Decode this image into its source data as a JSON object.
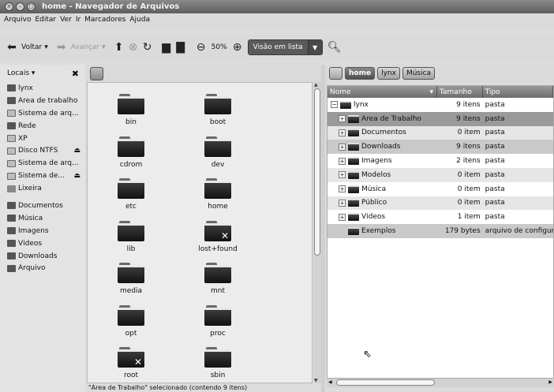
{
  "window": {
    "title": "home - Navegador de Arquivos",
    "buttons": [
      "close",
      "minimize",
      "maximize"
    ]
  },
  "menu": [
    "Arquivo",
    "Editar",
    "Ver",
    "Ir",
    "Marcadores",
    "Ajuda"
  ],
  "toolbar": {
    "back_label": "Voltar",
    "forward_label": "Avançar",
    "zoom_level": "50%",
    "view_mode": "Visão em lista"
  },
  "sidebar": {
    "header": "Locais ▾",
    "items": [
      {
        "label": "lynx",
        "icon": "home-icon"
      },
      {
        "label": "Área de trabalho",
        "icon": "desktop-icon"
      },
      {
        "label": "Sistema de arq...",
        "icon": "drive-icon"
      },
      {
        "label": "Rede",
        "icon": "network-icon"
      },
      {
        "label": "XP",
        "icon": "drive-icon"
      },
      {
        "label": "Disco NTFS",
        "icon": "drive-icon",
        "eject": true
      },
      {
        "label": "Sistema de arq...",
        "icon": "drive-icon"
      },
      {
        "label": "Sistema de...",
        "icon": "drive-icon",
        "eject": true
      },
      {
        "label": "Lixeira",
        "icon": "trash-icon"
      },
      {
        "label": "Documentos",
        "icon": "folder-icon"
      },
      {
        "label": "Música",
        "icon": "folder-icon"
      },
      {
        "label": "Imagens",
        "icon": "folder-icon"
      },
      {
        "label": "Vídeos",
        "icon": "folder-icon"
      },
      {
        "label": "Downloads",
        "icon": "folder-icon"
      },
      {
        "label": "Arquivo",
        "icon": "folder-icon"
      }
    ]
  },
  "icon_view": {
    "items": [
      {
        "label": "bin",
        "broken": false
      },
      {
        "label": "boot",
        "broken": false
      },
      {
        "label": "cdrom",
        "broken": false
      },
      {
        "label": "dev",
        "broken": false
      },
      {
        "label": "etc",
        "broken": false
      },
      {
        "label": "home",
        "broken": false
      },
      {
        "label": "lib",
        "broken": false
      },
      {
        "label": "lost+found",
        "broken": true
      },
      {
        "label": "media",
        "broken": false
      },
      {
        "label": "mnt",
        "broken": false
      },
      {
        "label": "opt",
        "broken": false
      },
      {
        "label": "proc",
        "broken": false
      },
      {
        "label": "root",
        "broken": true
      },
      {
        "label": "sbin",
        "broken": false
      }
    ]
  },
  "status": "\"Área de Trabalho\" selecionado (contendo 9 itens)",
  "right_pane": {
    "breadcrumbs": [
      "home",
      "lynx",
      "Música"
    ],
    "columns": [
      "Nome",
      "Tamanho",
      "Tipo"
    ],
    "rows": [
      {
        "name": "lynx",
        "size": "9 itens",
        "type": "pasta",
        "expander": "−",
        "level": 0
      },
      {
        "name": "Área de Trabalho",
        "size": "9 itens",
        "type": "pasta",
        "expander": "+",
        "level": 1
      },
      {
        "name": "Documentos",
        "size": "0 item",
        "type": "pasta",
        "expander": "+",
        "level": 1
      },
      {
        "name": "Downloads",
        "size": "9 itens",
        "type": "pasta",
        "expander": "+",
        "level": 1
      },
      {
        "name": "Imagens",
        "size": "2 itens",
        "type": "pasta",
        "expander": "+",
        "level": 1
      },
      {
        "name": "Modelos",
        "size": "0 item",
        "type": "pasta",
        "expander": "+",
        "level": 1
      },
      {
        "name": "Música",
        "size": "0 item",
        "type": "pasta",
        "expander": "+",
        "level": 1
      },
      {
        "name": "Público",
        "size": "0 item",
        "type": "pasta",
        "expander": "+",
        "level": 1
      },
      {
        "name": "Vídeos",
        "size": "1 item",
        "type": "pasta",
        "expander": "+",
        "level": 1
      },
      {
        "name": "Exemplos",
        "size": "179 bytes",
        "type": "arquivo de configura",
        "expander": "",
        "level": 1
      }
    ]
  }
}
